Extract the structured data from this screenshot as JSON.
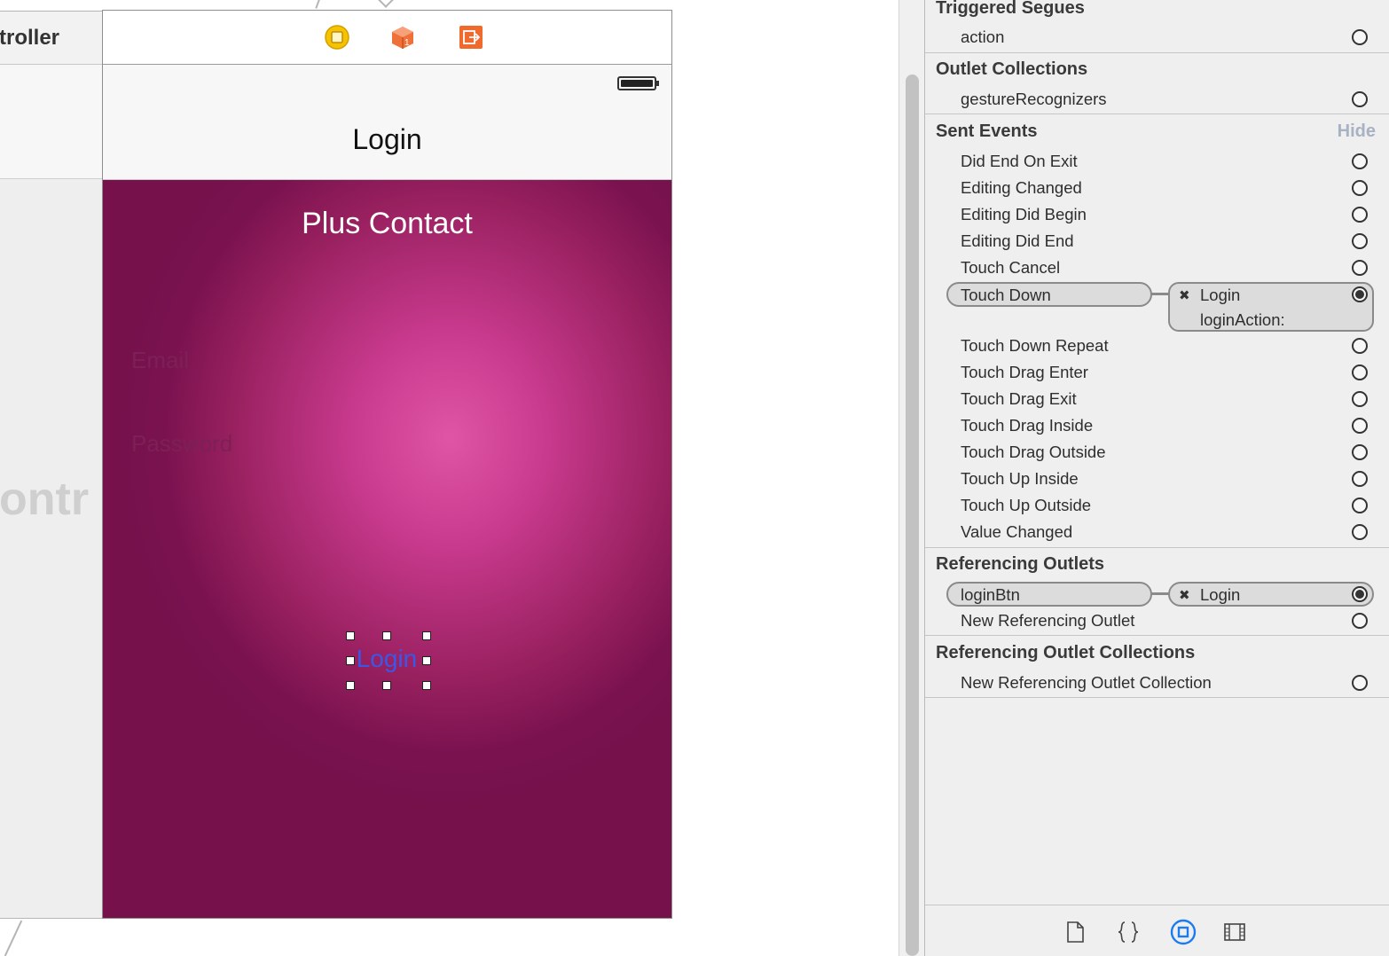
{
  "storyboard": {
    "previous_scene": {
      "title": "troller",
      "ghost_text": "ontr"
    },
    "nav_title": "Login",
    "app_title": "Plus Contact",
    "email_placeholder": "Email",
    "password_placeholder": "Password",
    "login_button_label": "Login",
    "dock_icons": [
      "view-controller-icon",
      "first-responder-icon",
      "exit-icon"
    ],
    "colors": {
      "content_bg": "#7a124f",
      "content_glow": "#e055a6",
      "button_text": "#3a58e8"
    }
  },
  "inspector": {
    "triggered_segues": {
      "title": "Triggered Segues",
      "items": [
        {
          "label": "action",
          "connected": false
        }
      ]
    },
    "outlet_collections": {
      "title": "Outlet Collections",
      "items": [
        {
          "label": "gestureRecognizers",
          "connected": false
        }
      ]
    },
    "sent_events": {
      "title": "Sent Events",
      "hide_label": "Hide",
      "items": [
        {
          "label": "Did End On Exit",
          "connected": false
        },
        {
          "label": "Editing Changed",
          "connected": false
        },
        {
          "label": "Editing Did Begin",
          "connected": false
        },
        {
          "label": "Editing Did End",
          "connected": false
        },
        {
          "label": "Touch Cancel",
          "connected": false
        },
        {
          "label": "Touch Down",
          "connected": true,
          "target": "Login",
          "action": "loginAction:"
        },
        {
          "label": "Touch Down Repeat",
          "connected": false
        },
        {
          "label": "Touch Drag Enter",
          "connected": false
        },
        {
          "label": "Touch Drag Exit",
          "connected": false
        },
        {
          "label": "Touch Drag Inside",
          "connected": false
        },
        {
          "label": "Touch Drag Outside",
          "connected": false
        },
        {
          "label": "Touch Up Inside",
          "connected": false
        },
        {
          "label": "Touch Up Outside",
          "connected": false
        },
        {
          "label": "Value Changed",
          "connected": false
        }
      ]
    },
    "referencing_outlets": {
      "title": "Referencing Outlets",
      "items": [
        {
          "label": "loginBtn",
          "connected": true,
          "target": "Login"
        },
        {
          "label": "New Referencing Outlet",
          "connected": false
        }
      ]
    },
    "referencing_outlet_collections": {
      "title": "Referencing Outlet Collections",
      "items": [
        {
          "label": "New Referencing Outlet Collection",
          "connected": false
        }
      ]
    },
    "bottom_tabs": [
      "file-inspector-icon",
      "quick-help-icon",
      "connections-inspector-icon",
      "media-library-icon"
    ]
  }
}
